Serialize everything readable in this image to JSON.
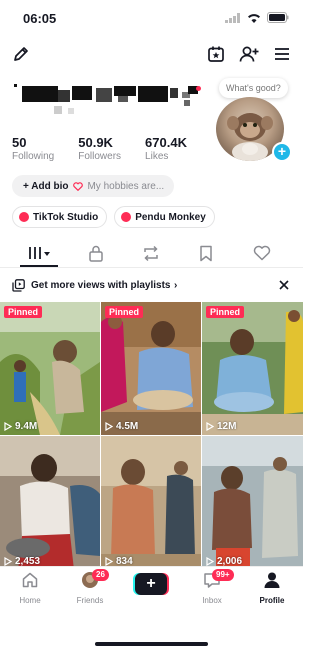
{
  "status": {
    "time": "06:05"
  },
  "profile": {
    "bubble": "What's good?",
    "stats": [
      {
        "value": "50",
        "label": "Following"
      },
      {
        "value": "50.9K",
        "label": "Followers"
      },
      {
        "value": "670.4K",
        "label": "Likes"
      }
    ],
    "bio_add": "+ Add bio",
    "bio_hint": "My hobbies are...",
    "links": [
      "TikTok Studio",
      "Pendu Monkey"
    ]
  },
  "promo": {
    "text": "Get more views with playlists"
  },
  "videos": [
    {
      "pinned": "Pinned",
      "views": "9.4M"
    },
    {
      "pinned": "Pinned",
      "views": "4.5M"
    },
    {
      "pinned": "Pinned",
      "views": "12M"
    },
    {
      "views": "2,453"
    },
    {
      "views": "834"
    },
    {
      "views": "2,006"
    }
  ],
  "nav": {
    "items": [
      "Home",
      "Friends",
      "Inbox",
      "Profile"
    ],
    "friends_badge": "26",
    "inbox_badge": "99+",
    "create": "+"
  },
  "colors": {
    "accent": "#fe2c55",
    "avatar_plus": "#20b8e8"
  }
}
